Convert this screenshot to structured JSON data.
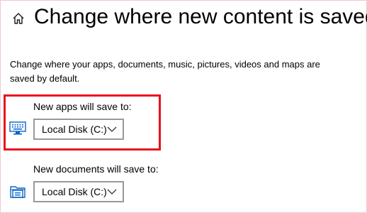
{
  "header": {
    "title": "Change where new content is saved",
    "home_icon": "home-icon"
  },
  "description": "Change where your apps, documents, music, pictures, videos and maps are saved by default.",
  "settings": [
    {
      "label": "New apps will save to:",
      "icon": "monitor-keyboard-icon",
      "selected_value": "Local Disk (C:)"
    },
    {
      "label": "New documents will save to:",
      "icon": "documents-folder-icon",
      "selected_value": "Local Disk (C:)"
    }
  ],
  "colors": {
    "highlight": "#e8121b",
    "icon_blue": "#0a64c8",
    "dropdown_border": "#999999"
  }
}
